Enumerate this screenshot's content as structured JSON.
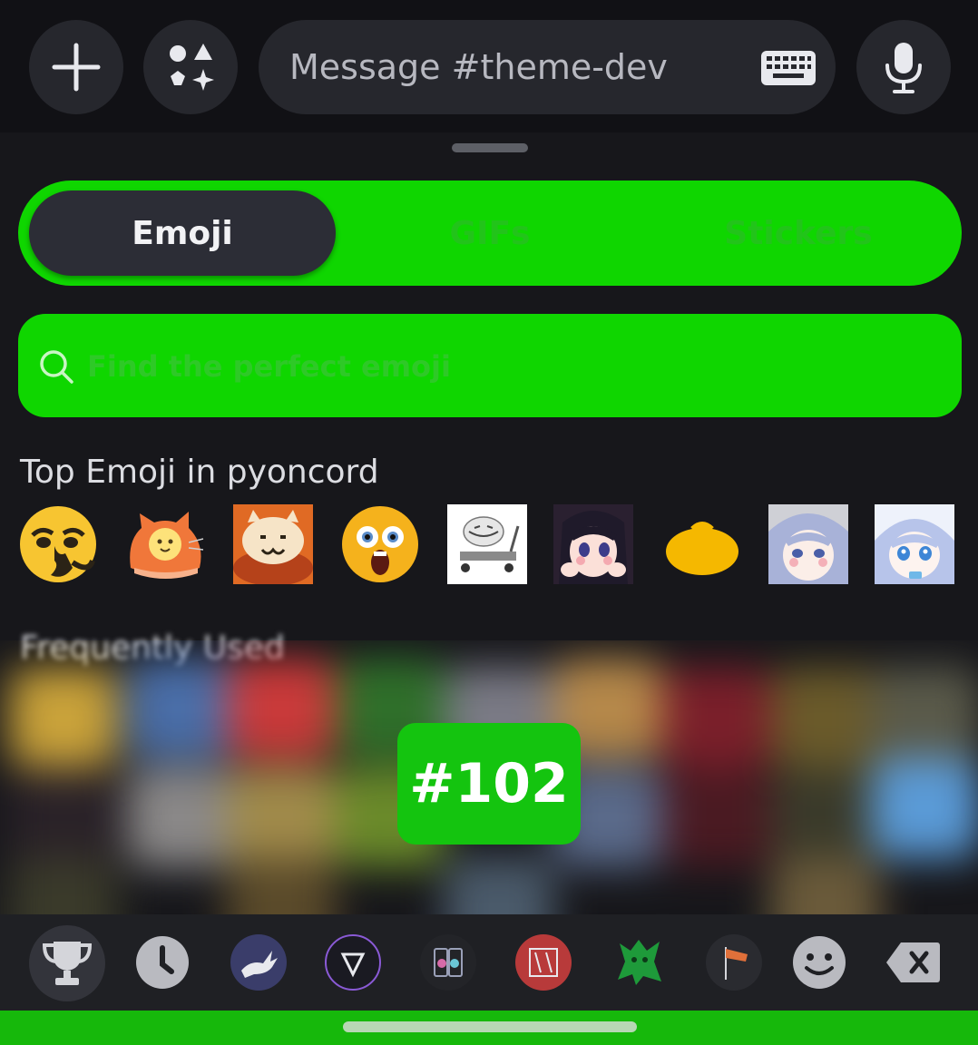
{
  "composer": {
    "placeholder": "Message #theme-dev",
    "icons": [
      "plus-icon",
      "apps-icon",
      "keyboard-icon",
      "microphone-icon"
    ]
  },
  "tabs": {
    "emoji_label": "Emoji",
    "gifs_label": "GIFs",
    "stickers_label": "Stickers",
    "selected": "Emoji"
  },
  "search": {
    "placeholder": "Find the perfect emoji"
  },
  "top_emoji": {
    "title": "Top Emoji in pyoncord",
    "items": [
      "gigachad-face",
      "orange-cat-blob",
      "nuke-cat",
      "shocked-face",
      "trollface-cart",
      "anime-girl-cheeks",
      "yellow-blob",
      "anime-girl-blush",
      "anime-girl-stare"
    ]
  },
  "frequent": {
    "title": "Frequently Used"
  },
  "badge": {
    "text": "#102"
  },
  "categories": [
    "trophy-icon",
    "clock-icon",
    "rabbit-icon",
    "v-logo-icon",
    "phone-cat-icon",
    "red-server-icon",
    "green-creature-icon",
    "windsock-icon",
    "smiley-icon",
    "backspace-icon"
  ],
  "colors": {
    "accent_green": "#0fd600",
    "panel_bg": "#17171b",
    "selected_tab_bg": "#2c2d36",
    "field_bg": "#26272d"
  }
}
